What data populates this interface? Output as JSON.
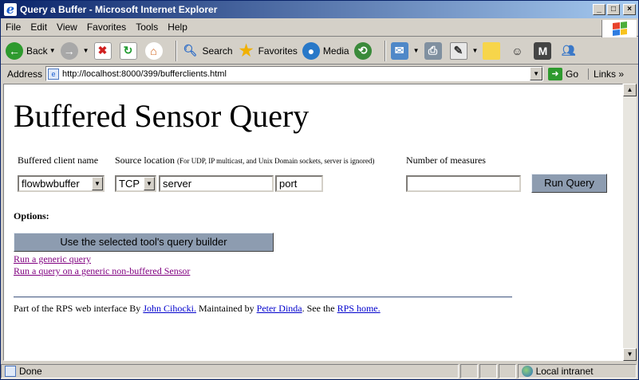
{
  "window": {
    "title": "Query a Buffer - Microsoft Internet Explorer"
  },
  "menu": [
    "File",
    "Edit",
    "View",
    "Favorites",
    "Tools",
    "Help"
  ],
  "toolbar": {
    "back": "Back",
    "search": "Search",
    "favorites": "Favorites",
    "media": "Media"
  },
  "address": {
    "label": "Address",
    "url": "http://localhost:8000/399/bufferclients.html",
    "go": "Go",
    "links": "Links"
  },
  "page": {
    "title": "Buffered Sensor Query",
    "labels": {
      "client_name": "Buffered client name",
      "source_location": "Source location",
      "source_note": "(For UDP, IP multicast, and Unix Domain sockets, server is ignored)",
      "num_measures": "Number of measures"
    },
    "form": {
      "client_select": "flowbwbuffer",
      "protocol_select": "TCP",
      "server_value": "server",
      "port_value": "port",
      "measures_value": "",
      "run_button": "Run Query"
    },
    "options": {
      "title": "Options:",
      "builder_button": "Use the selected tool's query builder",
      "generic_query": "Run a generic query",
      "non_buffered": "Run a query on a generic non-buffered Sensor"
    },
    "footer": {
      "prefix": "Part of the RPS web interface By ",
      "author": "John Cihocki.",
      "maintained": " Maintained by ",
      "maintainer": "Peter Dinda",
      "see": ". See the ",
      "home": "RPS home."
    }
  },
  "status": {
    "text": "Done",
    "zone": "Local intranet"
  }
}
